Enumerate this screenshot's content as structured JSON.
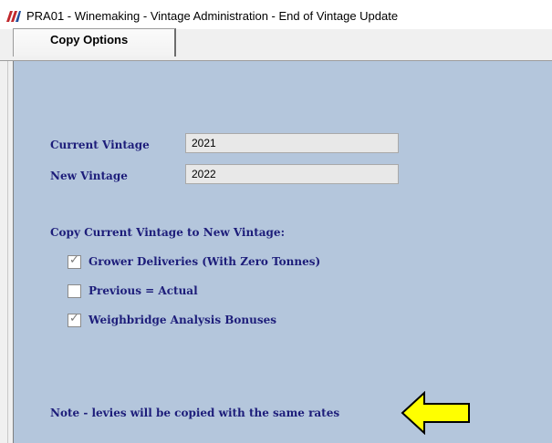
{
  "window": {
    "title": "PRA01 - Winemaking - Vintage Administration - End of Vintage Update"
  },
  "tabs": [
    {
      "label": "Copy Options",
      "selected": true
    }
  ],
  "form": {
    "current_vintage_label": "Current Vintage",
    "current_vintage_value": "2021",
    "new_vintage_label": "New Vintage",
    "new_vintage_value": "2022",
    "copy_heading": "Copy Current Vintage to New Vintage:",
    "options": [
      {
        "label": "Grower Deliveries (With Zero Tonnes)",
        "checked": true
      },
      {
        "label": "Previous = Actual",
        "checked": false
      },
      {
        "label": "Weighbridge Analysis Bonuses",
        "checked": true
      }
    ],
    "note": "Note - levies will be copied with the same rates"
  },
  "icons": {
    "app": "app-logo-icon",
    "pointer": "yellow-arrow-icon"
  },
  "colors": {
    "panel": "#b4c6dc",
    "label": "#1d1d7a",
    "arrow": "#ffff00"
  }
}
